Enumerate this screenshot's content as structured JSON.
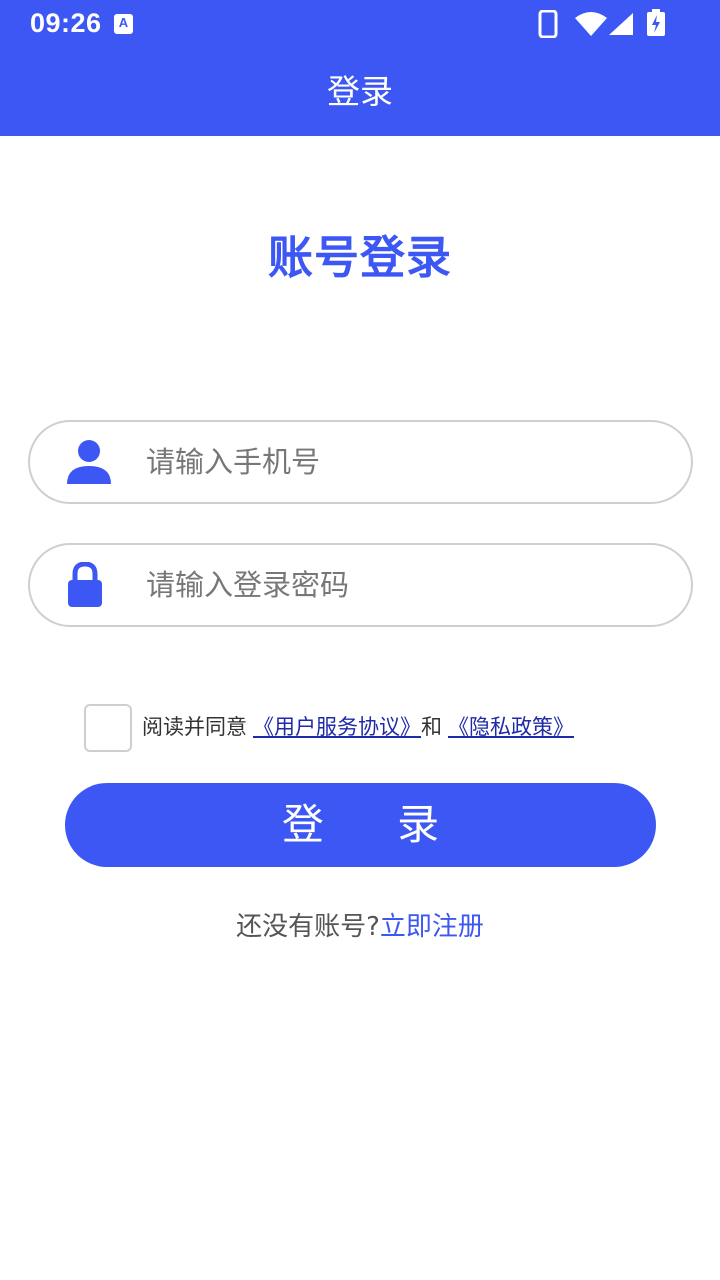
{
  "status_bar": {
    "time": "09:26",
    "notification_letter": "A",
    "icons": [
      "notification-a-icon",
      "phone-icon",
      "wifi-icon",
      "signal-icon",
      "battery-charging-icon"
    ]
  },
  "app_bar": {
    "title": "登录"
  },
  "heading": "账号登录",
  "phone_field": {
    "placeholder": "请输入手机号",
    "value": "",
    "icon": "user-icon"
  },
  "password_field": {
    "placeholder": "请输入登录密码",
    "value": "",
    "icon": "lock-icon"
  },
  "agreement": {
    "checked": false,
    "prefix": "阅读并同意",
    "user_agreement_link": "《用户服务协议》",
    "and": "和",
    "privacy_link": "《隐私政策》"
  },
  "login_button_label": "登 录",
  "register": {
    "prompt": "还没有账号?",
    "link": "立即注册"
  },
  "colors": {
    "primary": "#3d57f4",
    "link": "#1f2aa8",
    "border": "#cfcfcf"
  }
}
